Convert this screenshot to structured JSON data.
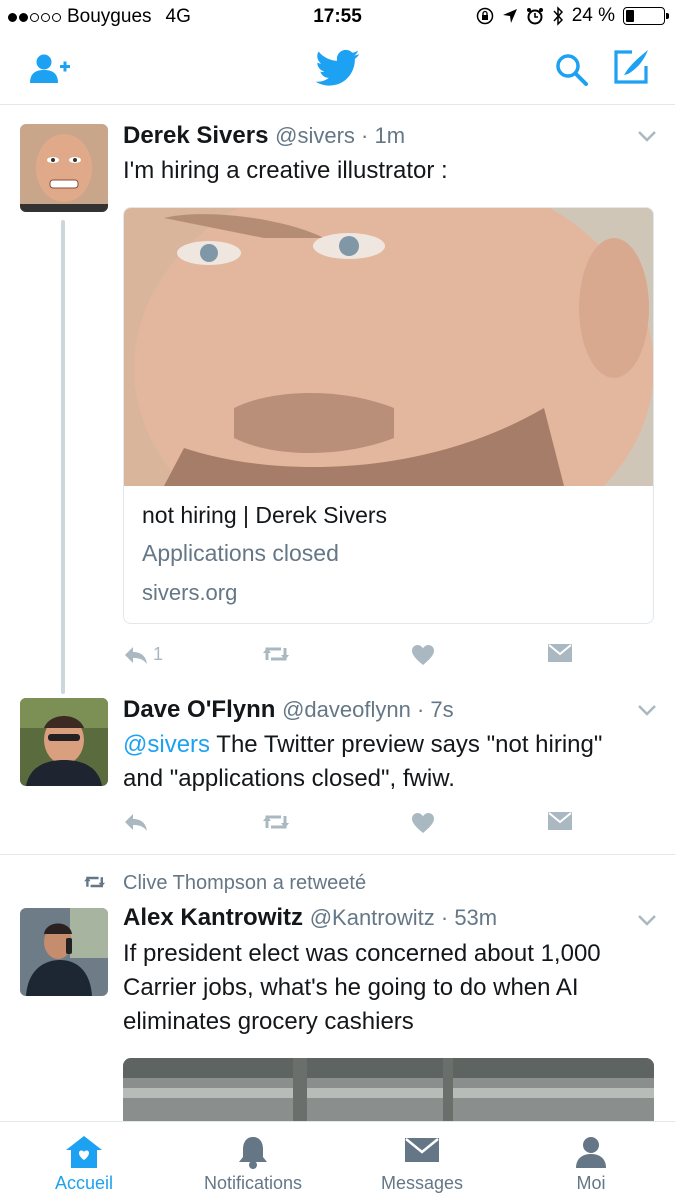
{
  "status_bar": {
    "carrier": "Bouygues",
    "network": "4G",
    "time": "17:55",
    "battery_percent": "24 %",
    "battery_level": 0.24,
    "icons": [
      "orientation-lock-icon",
      "location-icon",
      "alarm-icon",
      "bluetooth-icon",
      "battery-icon"
    ]
  },
  "nav": {
    "left_icon": "add-user-icon",
    "center_icon": "twitter-bird-icon",
    "right_icons": [
      "search-icon",
      "compose-icon"
    ],
    "accent": "#1da1f2"
  },
  "tweets": [
    {
      "name": "Derek Sivers",
      "handle": "@sivers",
      "time": "1m",
      "text": "I'm hiring a creative illustrator :",
      "card": {
        "title": "not hiring | Derek Sivers",
        "description": "Applications closed",
        "domain": "sivers.org"
      },
      "reply_count": "1"
    },
    {
      "name": "Dave O'Flynn",
      "handle": "@daveoflynn",
      "time": "7s",
      "mention": "@sivers",
      "text": " The Twitter preview says \"not hiring\" and \"applications closed\", fwiw."
    },
    {
      "retweeted_by": "Clive Thompson a retweeté",
      "name": "Alex Kantrowitz",
      "handle": "@Kantrowitz",
      "time": "53m",
      "text": "If president elect was concerned about 1,000 Carrier jobs, what's he going to do when AI eliminates grocery cashiers"
    }
  ],
  "tabs": [
    {
      "label": "Accueil",
      "icon": "home-icon",
      "active": true
    },
    {
      "label": "Notifications",
      "icon": "bell-icon",
      "active": false
    },
    {
      "label": "Messages",
      "icon": "envelope-icon",
      "active": false
    },
    {
      "label": "Moi",
      "icon": "profile-icon",
      "active": false
    }
  ]
}
